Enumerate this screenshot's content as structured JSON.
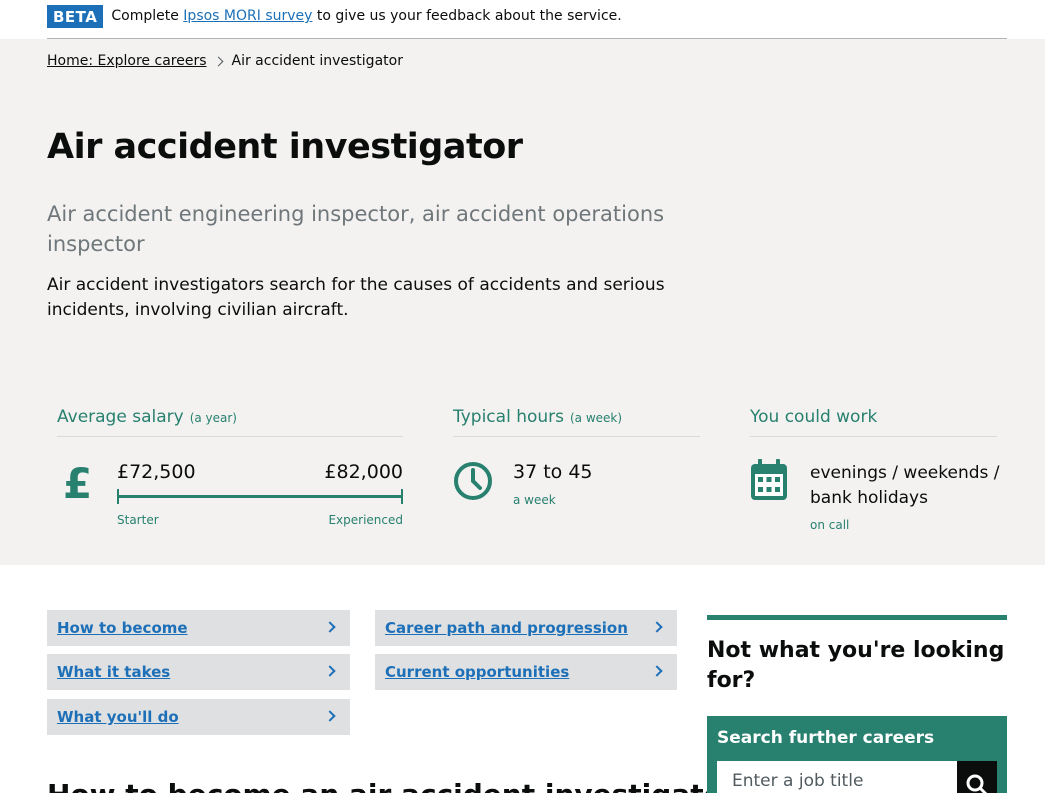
{
  "beta": {
    "tag": "BETA",
    "text_before": "Complete",
    "link": "Ipsos MORI survey",
    "text_after": "to give us your feedback about the service."
  },
  "breadcrumb": {
    "home": "Home: Explore careers",
    "current": "Air accident investigator"
  },
  "job": {
    "title": "Air accident investigator",
    "alternative_titles": "Air accident engineering inspector, air accident operations inspector",
    "summary": "Air accident investigators search for the causes of accidents and serious incidents, involving civilian aircraft."
  },
  "salary": {
    "heading": "Average salary",
    "qualifier": "(a year)",
    "starter_value": "£72,500",
    "experienced_value": "£82,000",
    "starter_label": "Starter",
    "experienced_label": "Experienced",
    "icon": "£"
  },
  "hours": {
    "heading": "Typical hours",
    "qualifier": "(a week)",
    "value": "37 to 45",
    "unit": "a week",
    "icon": "clock-icon"
  },
  "work": {
    "heading": "You could work",
    "value": "evenings / weekends / bank holidays",
    "sub": "on call",
    "icon": "calendar-icon"
  },
  "nav": {
    "how_to_become": "How to become",
    "what_it_takes": "What it takes",
    "what_youll_do": "What you'll do",
    "career_path": "Career path and progression",
    "current_opportunities": "Current opportunities"
  },
  "lower_heading": "How to become an air accident investigator",
  "sidebar": {
    "title": "Not what you're looking for?",
    "search_label": "Search further careers",
    "search_placeholder": "Enter a job title"
  },
  "colors": {
    "accent": "#28806f",
    "link": "#1d70b8",
    "hero_bg": "#f3f2f1"
  }
}
